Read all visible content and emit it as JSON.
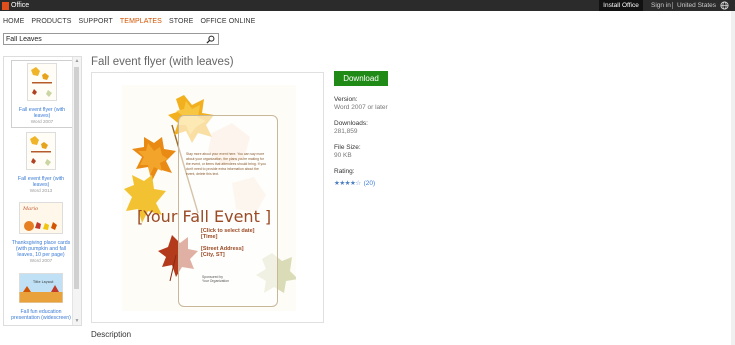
{
  "topbar": {
    "logo_text": "Office",
    "install": "Install Office",
    "signin": "Sign in",
    "region": "United States"
  },
  "nav": [
    "HOME",
    "PRODUCTS",
    "SUPPORT",
    "TEMPLATES",
    "STORE",
    "OFFICE ONLINE"
  ],
  "nav_active": "TEMPLATES",
  "search": {
    "value": "Fall Leaves"
  },
  "thumbnails": [
    {
      "caption": "Fall event flyer (with leaves)",
      "version": "Word 2007",
      "preview_text": "[Your Fall Event]"
    },
    {
      "caption": "Fall event flyer (with leaves)",
      "version": "Word 2013",
      "preview_text": "[Your Fall Event]"
    },
    {
      "caption": "Thanksgiving place cards (with pumpkin and fall leaves, 10 per page)",
      "version": "Word 2007",
      "preview_text": "Mario"
    },
    {
      "caption": "Fall fun education presentation (widescreen)",
      "version": "",
      "preview_text": "Title Layout"
    }
  ],
  "template": {
    "title": "Fall event flyer (with leaves)",
    "download": "Download",
    "version_label": "Version:",
    "version_value": "Word 2007 or later",
    "downloads_label": "Downloads:",
    "downloads_value": "281,859",
    "filesize_label": "File Size:",
    "filesize_value": "90 KB",
    "rating_label": "Rating:",
    "rating_stars": "★★★★☆",
    "rating_count": "(20)",
    "description_heading": "Description"
  },
  "flyer": {
    "body_text": "Stay more about your event here. You can say more about your organization, the plans you're making for the event, or items that attendees should bring. If you don't need to provide extra information about the event, delete this text.",
    "event_title": "[Your Fall Event ]",
    "date_line": "[Click to select date]",
    "time_line": "[Time]",
    "address_line": "[Street Address]",
    "city_line": "[City, ST]",
    "sponsor_label": "Sponsored by",
    "sponsor_org": "Your Organization"
  },
  "colors": {
    "topbar": "#2b2b2b",
    "accent_nav": "#d35400",
    "download_green": "#1f8a15",
    "link_blue": "#3a7bd5",
    "flyer_brown": "#9a4a25"
  }
}
